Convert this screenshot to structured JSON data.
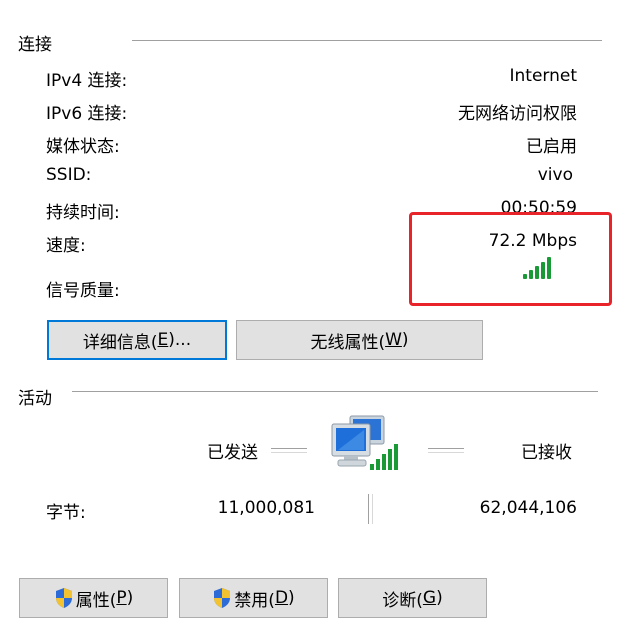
{
  "connection": {
    "title": "连接",
    "rows": [
      {
        "label": "IPv4 连接:",
        "value": "Internet"
      },
      {
        "label": "IPv6 连接:",
        "value": "无网络访问权限"
      },
      {
        "label": "媒体状态:",
        "value": "已启用"
      },
      {
        "label": "SSID:",
        "value": "vivo"
      },
      {
        "label": "持续时间:",
        "value": "00:50:59"
      },
      {
        "label": "速度:",
        "value": "72.2 Mbps"
      }
    ],
    "signal_label": "信号质量:",
    "signal_strength": "5/5",
    "details_button": {
      "text": "详细信息(",
      "key": "E",
      "suffix": ")..."
    },
    "wireless_button": {
      "text": "无线属性(",
      "key": "W",
      "suffix": ")"
    }
  },
  "activity": {
    "title": "活动",
    "sent_label": "已发送",
    "received_label": "已接收",
    "bytes_label": "字节:",
    "bytes_sent": "11,000,081",
    "bytes_received": "62,044,106"
  },
  "footer": {
    "properties_button": {
      "text": "属性(",
      "key": "P",
      "suffix": ")"
    },
    "disable_button": {
      "text": "禁用(",
      "key": "D",
      "suffix": ")"
    },
    "diagnose_button": {
      "text": "诊断(",
      "key": "G",
      "suffix": ")"
    }
  },
  "colors": {
    "accent": "#0078d7",
    "signal": "#1a9a36",
    "highlight": "#e8232a",
    "button_bg": "#e1e1e1"
  }
}
